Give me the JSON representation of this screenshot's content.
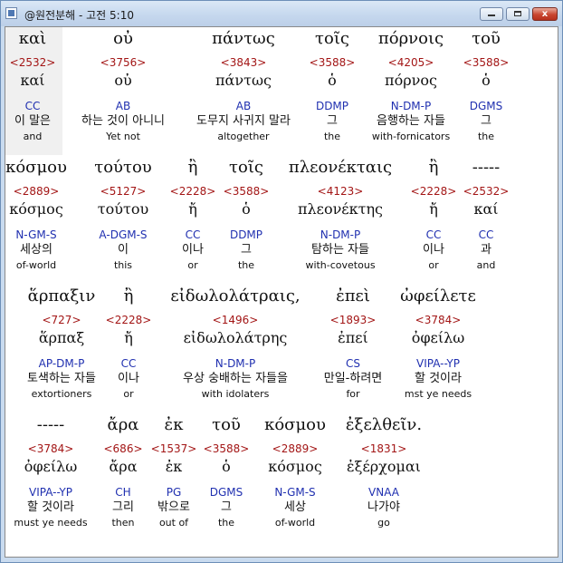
{
  "window": {
    "title": "@원전분해 - 고전 5:10",
    "min_label": "",
    "max_label": "",
    "close_label": "x"
  },
  "rows": [
    {
      "words": [
        {
          "greek": "καὶ",
          "strong": "<2532>",
          "lemma": "καί",
          "morph": "CC",
          "korean": "이 말은",
          "english": "and"
        },
        {
          "greek": "οὐ",
          "strong": "<3756>",
          "lemma": "οὐ",
          "morph": "AB",
          "korean": "하는 것이 아니니",
          "english": "Yet not"
        },
        {
          "greek": "πάντως",
          "strong": "<3843>",
          "lemma": "πάντως",
          "morph": "AB",
          "korean": "도무지 사귀지 말라",
          "english": "altogether"
        },
        {
          "greek": "τοῖς",
          "strong": "<3588>",
          "lemma": "ὁ",
          "morph": "DDMP",
          "korean": "그",
          "english": "the"
        },
        {
          "greek": "πόρνοις",
          "strong": "<4205>",
          "lemma": "πόρνος",
          "morph": "N-DM-P",
          "korean": "음행하는 자들",
          "english": "with-fornicators"
        },
        {
          "greek": "τοῦ",
          "strong": "<3588>",
          "lemma": "ὁ",
          "morph": "DGMS",
          "korean": "그",
          "english": "the"
        }
      ]
    },
    {
      "words": [
        {
          "greek": "κόσμου",
          "strong": "<2889>",
          "lemma": "κόσμος",
          "morph": "N-GM-S",
          "korean": "세상의",
          "english": "of-world"
        },
        {
          "greek": "τούτου",
          "strong": "<5127>",
          "lemma": "τούτου",
          "morph": "A-DGM-S",
          "korean": "이",
          "english": "this"
        },
        {
          "greek": "ἢ",
          "strong": "<2228>",
          "lemma": "ἤ",
          "morph": "CC",
          "korean": "이나",
          "english": "or"
        },
        {
          "greek": "τοῖς",
          "strong": "<3588>",
          "lemma": "ὁ",
          "morph": "DDMP",
          "korean": "그",
          "english": "the"
        },
        {
          "greek": "πλεονέκταις",
          "strong": "<4123>",
          "lemma": "πλεονέκτης",
          "morph": "N-DM-P",
          "korean": "탐하는 자들",
          "english": "with-covetous"
        },
        {
          "greek": "ἢ",
          "strong": "<2228>",
          "lemma": "ἤ",
          "morph": "CC",
          "korean": "이나",
          "english": "or"
        },
        {
          "greek": "-----",
          "strong": "<2532>",
          "lemma": "καί",
          "morph": "CC",
          "korean": "과",
          "english": "and"
        }
      ]
    },
    {
      "words": [
        {
          "greek": "ἅρπαξιν",
          "strong": "<727>",
          "lemma": "ἅρπαξ",
          "morph": "AP-DM-P",
          "korean": "토색하는 자들",
          "english": "extortioners"
        },
        {
          "greek": "ἢ",
          "strong": "<2228>",
          "lemma": "ἤ",
          "morph": "CC",
          "korean": "이나",
          "english": "or"
        },
        {
          "greek": "εἰδωλολάτραις,",
          "strong": "<1496>",
          "lemma": "εἰδωλολάτρης",
          "morph": "N-DM-P",
          "korean": "우상 숭배하는 자들을",
          "english": "with idolaters"
        },
        {
          "greek": "ἐπεὶ",
          "strong": "<1893>",
          "lemma": "ἐπεί",
          "morph": "CS",
          "korean": "만일-하려면",
          "english": "for"
        },
        {
          "greek": "ὠφείλετε",
          "strong": "<3784>",
          "lemma": "ὀφείλω",
          "morph": "VIPA--YP",
          "korean": "할 것이라",
          "english": "mst ye needs"
        }
      ]
    },
    {
      "words": [
        {
          "greek": "-----",
          "strong": "<3784>",
          "lemma": "ὀφείλω",
          "morph": "VIPA--YP",
          "korean": "할 것이라",
          "english": "must ye needs"
        },
        {
          "greek": "ἄρα",
          "strong": "<686>",
          "lemma": "ἄρα",
          "morph": "CH",
          "korean": "그리",
          "english": "then"
        },
        {
          "greek": "ἐκ",
          "strong": "<1537>",
          "lemma": "ἐκ",
          "morph": "PG",
          "korean": "밖으로",
          "english": "out of"
        },
        {
          "greek": "τοῦ",
          "strong": "<3588>",
          "lemma": "ὁ",
          "morph": "DGMS",
          "korean": "그",
          "english": "the"
        },
        {
          "greek": "κόσμου",
          "strong": "<2889>",
          "lemma": "κόσμος",
          "morph": "N-GM-S",
          "korean": "세상",
          "english": "of-world"
        },
        {
          "greek": "ἐξελθεῖν.",
          "strong": "<1831>",
          "lemma": "ἐξέρχομαι",
          "morph": "VNAA",
          "korean": "나가야",
          "english": "go"
        }
      ]
    }
  ]
}
